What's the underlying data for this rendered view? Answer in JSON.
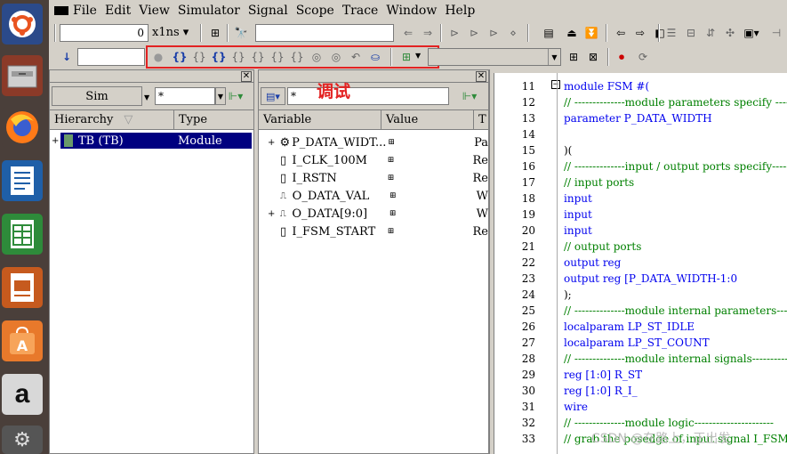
{
  "menu": [
    "File",
    "Edit",
    "View",
    "Simulator",
    "Signal",
    "Scope",
    "Trace",
    "Window",
    "Help"
  ],
  "toolbar": {
    "time_value": "0",
    "time_unit": "x1ns",
    "search_value": "",
    "highlight_label": "调试"
  },
  "left_pane": {
    "sim_label": "Sim",
    "filter": "*",
    "columns": [
      "Hierarchy",
      "Type"
    ],
    "rows": [
      {
        "name": "TB (TB)",
        "type": "Module"
      }
    ]
  },
  "mid_pane": {
    "filter": "*",
    "columns": [
      "Variable",
      "Value",
      "T"
    ],
    "rows": [
      {
        "name": "P_DATA_WIDT...",
        "type": "Pa",
        "icon": "param-icon"
      },
      {
        "name": "I_CLK_100M",
        "type": "Re",
        "icon": "reg-icon"
      },
      {
        "name": "I_RSTN",
        "type": "Re",
        "icon": "reg-icon"
      },
      {
        "name": "O_DATA_VAL",
        "type": "W",
        "icon": "wire-icon"
      },
      {
        "name": "O_DATA[9:0]",
        "type": "W",
        "icon": "wire-icon"
      },
      {
        "name": "I_FSM_START",
        "type": "Re",
        "icon": "reg-icon"
      }
    ]
  },
  "code": {
    "lines": [
      {
        "n": "11",
        "t": "module FSM #("
      },
      {
        "n": "12",
        "t": "// --------------module parameters specify ------"
      },
      {
        "n": "13",
        "t": "parameter              P_DATA_WIDTH"
      },
      {
        "n": "14",
        "t": ""
      },
      {
        "n": "15",
        "t": ")("
      },
      {
        "n": "16",
        "t": "// --------------input / output ports specify--------"
      },
      {
        "n": "17",
        "t": "// input ports"
      },
      {
        "n": "18",
        "t": "input"
      },
      {
        "n": "19",
        "t": "input"
      },
      {
        "n": "20",
        "t": "input"
      },
      {
        "n": "21",
        "t": "// output ports"
      },
      {
        "n": "22",
        "t": "output reg"
      },
      {
        "n": "23",
        "t": "output reg                  [P_DATA_WIDTH-1:0"
      },
      {
        "n": "24",
        "t": "        );"
      },
      {
        "n": "25",
        "t": "// --------------module internal parameters-------"
      },
      {
        "n": "26",
        "t": "localparam                    LP_ST_IDLE"
      },
      {
        "n": "27",
        "t": "localparam                    LP_ST_COUNT"
      },
      {
        "n": "28",
        "t": "// --------------module internal signals-----------"
      },
      {
        "n": "29",
        "t": "reg                       [1:0]                  R_ST"
      },
      {
        "n": "30",
        "t": "reg                       [1:0]                  R_I_"
      },
      {
        "n": "31",
        "t": "wire"
      },
      {
        "n": "32",
        "t": "// --------------module logic----------------------"
      },
      {
        "n": "33",
        "t": "// grab the posedge of input signal I_FSM_S"
      }
    ]
  },
  "watermark": "CSDN @在路上，正出发",
  "colors": {
    "selection": "#000080",
    "highlight_box": "#e32222",
    "keyword": "#0000ee",
    "comment": "#008000"
  }
}
